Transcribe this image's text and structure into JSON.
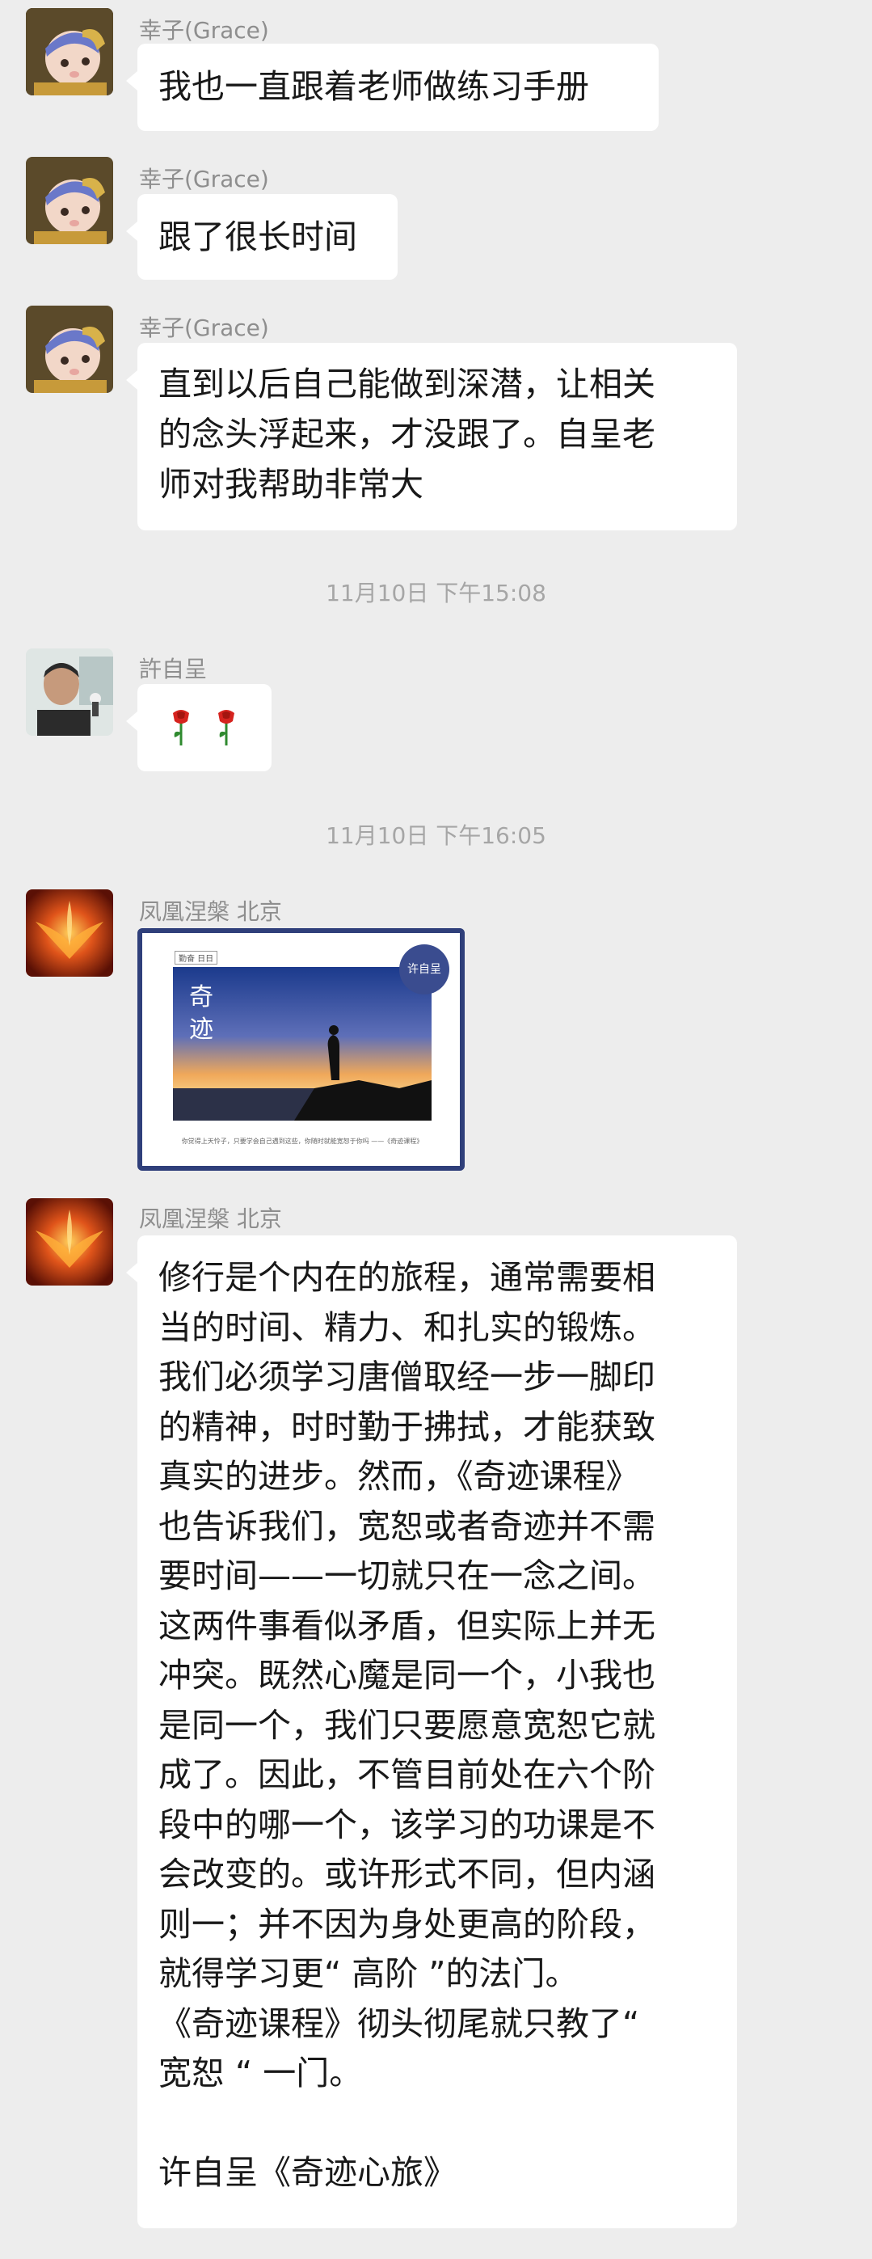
{
  "messages": [
    {
      "name": "幸子(Grace)",
      "text": "我也一直跟着老师做练习手册"
    },
    {
      "name": "幸子(Grace)",
      "text": "跟了很长时间"
    },
    {
      "name": "幸子(Grace)",
      "lines": [
        "直到以后自己能做到深潜，让相关",
        "的念头浮起来，才没跟了。自呈老",
        "师对我帮助非常大"
      ]
    }
  ],
  "timestamps": [
    "11月10日 下午15:08",
    "11月10日 下午16:05"
  ],
  "xu_message": {
    "name": "許自呈",
    "emoji": [
      "rose-icon",
      "rose-icon"
    ]
  },
  "phoenix_card": {
    "name": "凤凰涅槃 北京",
    "tag": "勤奋 日日",
    "title": "奇迹",
    "badge": "许自呈",
    "caption": "你觉得上天怜子，只要学会自己遇到这些，你随时就能宽恕于你吗 ——《奇迹课程》"
  },
  "phoenix_text": {
    "name": "凤凰涅槃 北京",
    "lines": [
      "修行是个内在的旅程，通常需要相",
      "当的时间、精力、和扎实的锻炼。",
      "我们必须学习唐僧取经一步一脚印",
      "的精神，时时勤于拂拭，才能获致",
      "真实的进步。然而，《奇迹课程》",
      "也告诉我们，宽恕或者奇迹并不需",
      "要时间——一切就只在一念之间。",
      "这两件事看似矛盾，但实际上并无",
      "冲突。既然心魔是同一个，小我也",
      "是同一个，我们只要愿意宽恕它就",
      "成了。因此，不管目前处在六个阶",
      "段中的哪一个，该学习的功课是不",
      "会改变的。或许形式不同，但内涵",
      "则一；并不因为身处更高的阶段，",
      "就得学习更“ 高阶 ”的法门。",
      "《奇迹课程》彻头彻尾就只教了“",
      "宽恕 “ 一门。",
      "",
      "许自呈《奇迹心旅》"
    ]
  },
  "colors": {
    "background": "#ededed",
    "bubble": "#ffffff",
    "name_text": "#8e8e8e",
    "time_text": "#a6a6a6",
    "card_border": "#2f3f7a"
  }
}
